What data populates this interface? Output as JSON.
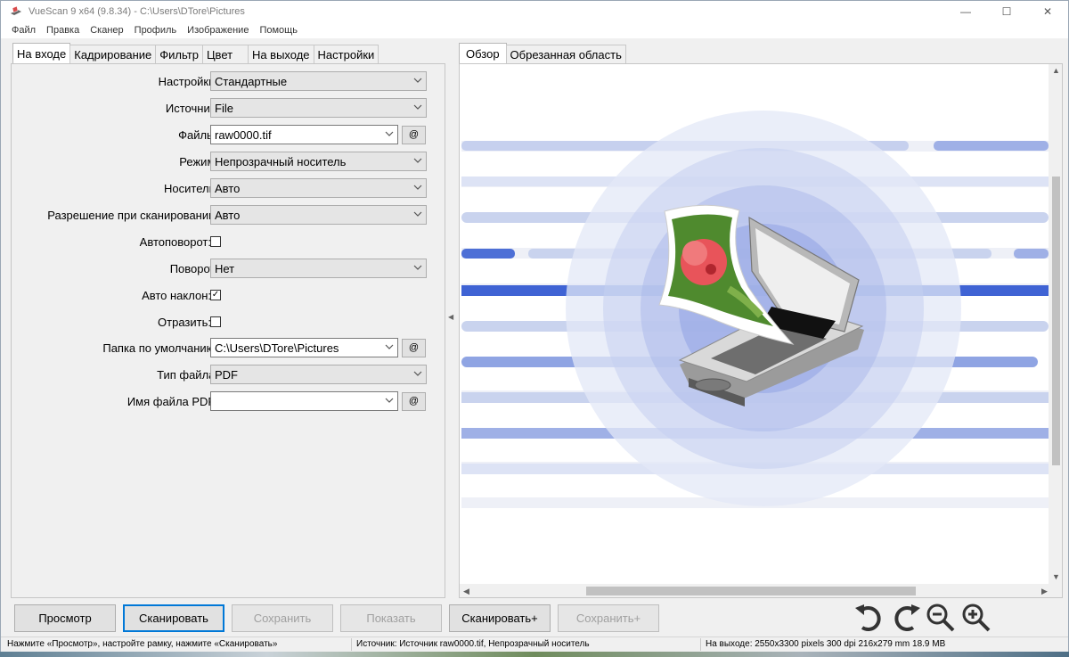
{
  "window": {
    "title": "VueScan 9 x64 (9.8.34) - C:\\Users\\DTore\\Pictures",
    "controls": {
      "minimize": "—",
      "maximize": "☐",
      "close": "✕"
    }
  },
  "menu": [
    "Файл",
    "Правка",
    "Сканер",
    "Профиль",
    "Изображение",
    "Помощь"
  ],
  "left_tabs": [
    "На входе",
    "Кадрирование",
    "Фильтр",
    "Цвет",
    "На выходе",
    "Настройки"
  ],
  "left_active_tab": "На входе",
  "right_tabs": [
    "Обзор",
    "Обрезанная область"
  ],
  "right_active_tab": "Обзор",
  "form": {
    "settings": {
      "label": "Настройки:",
      "value": "Стандартные"
    },
    "source": {
      "label": "Источник:",
      "value": "File"
    },
    "files": {
      "label": "Файлы:",
      "value": "raw0000.tif",
      "button": "@"
    },
    "mode": {
      "label": "Режим:",
      "value": "Непрозрачный носитель"
    },
    "media": {
      "label": "Носитель:",
      "value": "Авто"
    },
    "resolution": {
      "label": "Разрешение при сканировании:",
      "value": "Авто"
    },
    "autorotate": {
      "label": "Автоповорот:",
      "checked": false,
      "mark": ""
    },
    "rotation": {
      "label": "Поворот:",
      "value": "Нет"
    },
    "auto_deskew": {
      "label": "Авто наклон:",
      "checked": true,
      "mark": "✓"
    },
    "mirror": {
      "label": "Отразить:",
      "checked": false,
      "mark": ""
    },
    "default_folder": {
      "label": "Папка по умолчанию:",
      "value": "C:\\Users\\DTore\\Pictures",
      "button": "@"
    },
    "file_type": {
      "label": "Тип файла:",
      "value": "PDF"
    },
    "pdf_name": {
      "label": "Имя файла PDF:",
      "value": "",
      "button": "@"
    }
  },
  "buttons": {
    "preview": "Просмотр",
    "scan": "Сканировать",
    "save": "Сохранить",
    "show": "Показать",
    "scan_plus": "Сканировать+",
    "save_plus": "Сохранить+"
  },
  "status": {
    "hint": "Нажмите «Просмотр», настройте рамку, нажмите «Сканировать»",
    "source": "Источник: Источник raw0000.tif, Непрозрачный носитель",
    "output": "На выходе: 2550x3300 pixels 300 dpi 216x279 mm 18.9 MB"
  },
  "colors": {
    "accent": "#0078d7",
    "stripe_blue": "#4d72d6",
    "stripe_light": "#c9d3ee"
  }
}
